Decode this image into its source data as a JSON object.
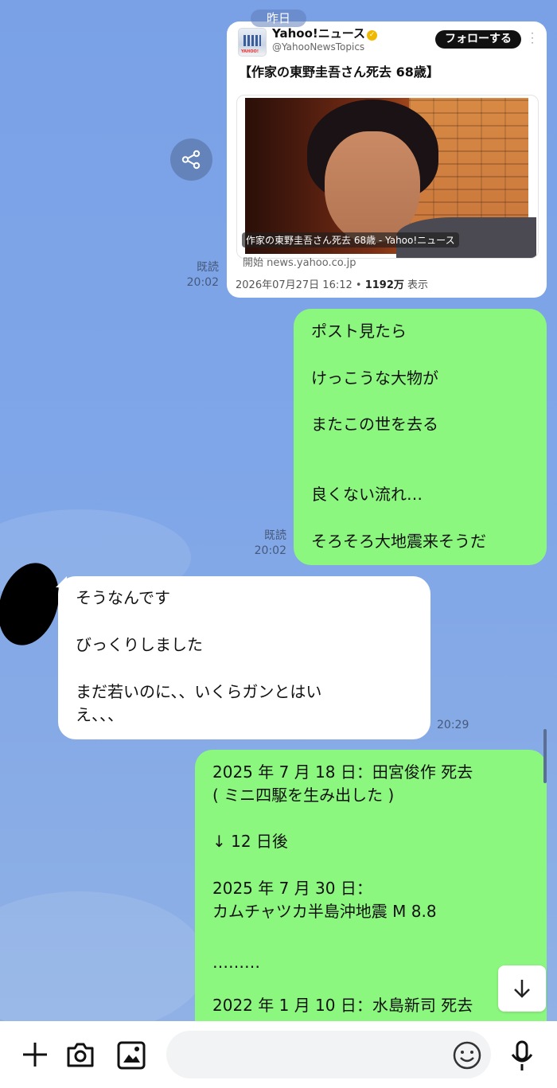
{
  "date_divider": "昨日",
  "shared_post": {
    "account_name": "Yahoo!ニュース",
    "account_handle": "@YahooNewsTopics",
    "follow_label": "フォローする",
    "headline": "【作家の東野圭吾さん死去 68歳】",
    "photo_caption": "作家の東野圭吾さん死去 68歳 - Yahoo!ニュース",
    "source": "開始 news.yahoo.co.jp",
    "posted_at": "2026年07月27日 16:12",
    "separator": "•",
    "views_count": "1192万",
    "views_label": "表示"
  },
  "receipts": {
    "read_label": "既読",
    "card_time": "20:02",
    "msg1_time": "20:02"
  },
  "messages": {
    "sent_1": [
      "ポスト見たら",
      "けっこうな大物が",
      "またこの世を去る",
      "良くない流れ…",
      "そろそろ大地震来そうだ"
    ],
    "received_1": [
      "そうなんです",
      "びっくりしました",
      "まだ若いのに、、いくらガンとはい",
      "え、、、"
    ],
    "received_1_time": "20:29",
    "sent_2": [
      "2025 年 7 月 18 日：田宮俊作 死去",
      "( ミニ四駆を生み出した )",
      "↓ 12 日後",
      "2025 年 7 月 30 日：",
      "カムチャツカ半島沖地震  M 8.8",
      "………",
      "2022 年 1 月 10 日：水島新司 死去"
    ]
  },
  "composer": {
    "placeholder": ""
  },
  "icons": {
    "share": "share-icon",
    "scroll_down": "arrow-down-icon",
    "plus": "plus-icon",
    "camera": "camera-icon",
    "image": "image-icon",
    "emoji": "emoji-icon",
    "mic": "microphone-icon"
  },
  "colors": {
    "chat_background": "#7ea4e5",
    "sent_bubble": "#8cf77e",
    "received_bubble": "#ffffff",
    "follow_button": "#111111"
  }
}
